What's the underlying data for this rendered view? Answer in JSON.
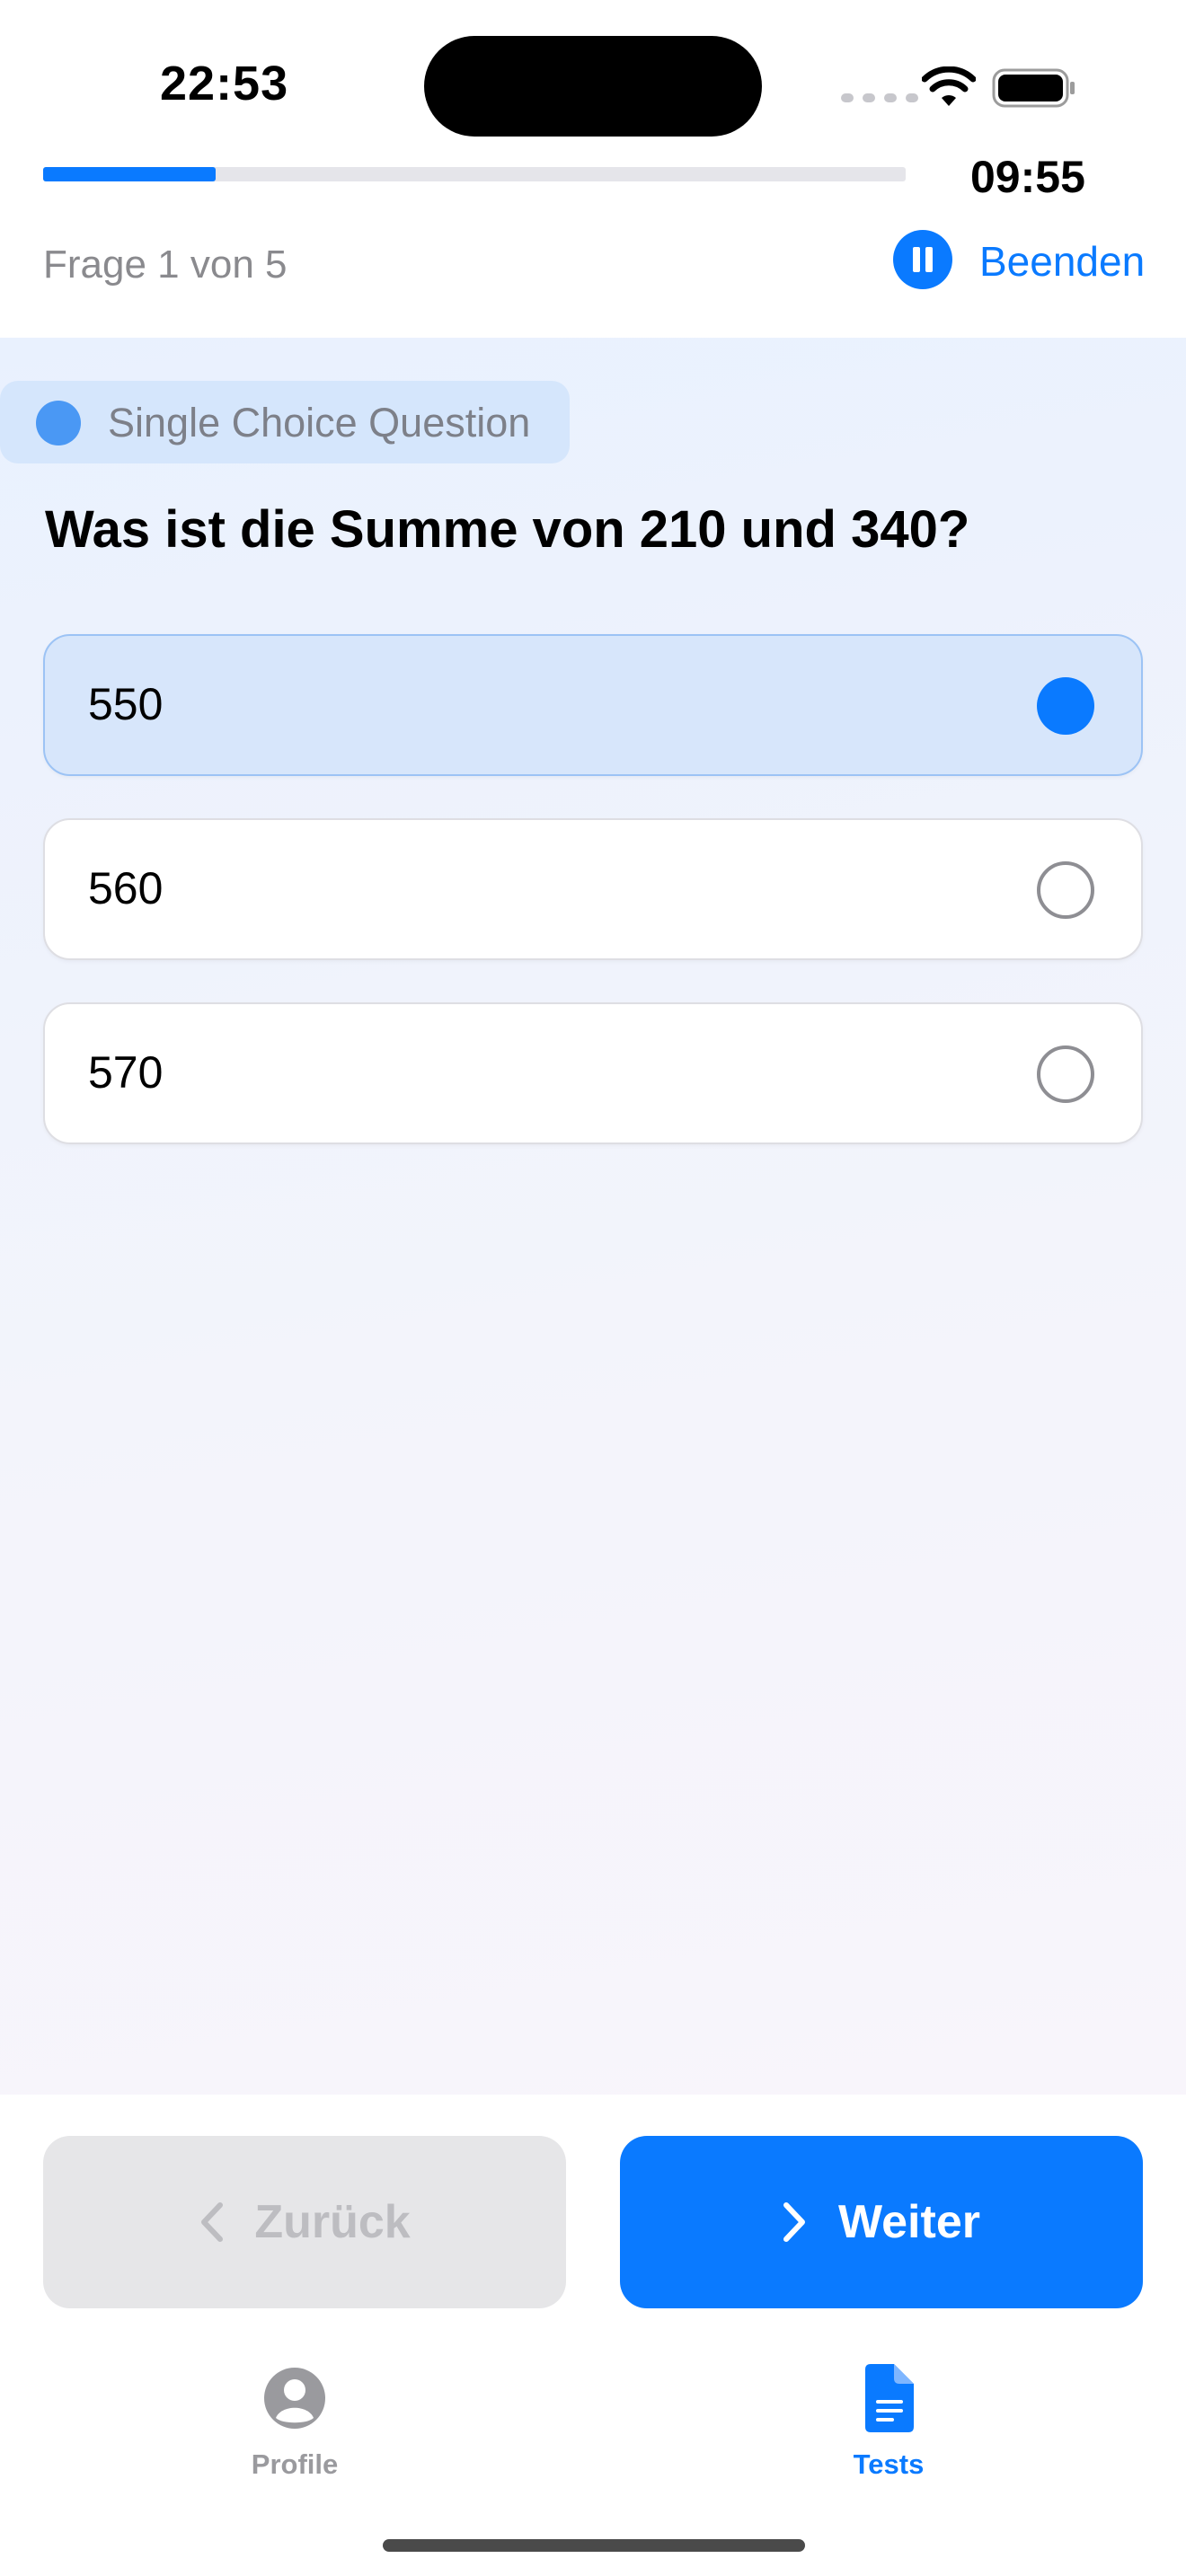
{
  "status_bar": {
    "time": "22:53",
    "icons": [
      "signal-dots-icon",
      "wifi-icon",
      "battery-icon"
    ]
  },
  "quiz_header": {
    "progress_fraction": 0.2,
    "timer": "09:55",
    "question_count": "Frage 1 von 5",
    "pause_icon": "pause-icon",
    "end_label": "Beenden"
  },
  "question": {
    "type_label": "Single Choice Question",
    "text": "Was ist die Summe von 210 und 340?",
    "options": [
      {
        "label": "550",
        "selected": true
      },
      {
        "label": "560",
        "selected": false
      },
      {
        "label": "570",
        "selected": false
      }
    ]
  },
  "navigation": {
    "back_label": "Zurück",
    "back_icon": "chevron-left-icon",
    "back_enabled": false,
    "next_label": "Weiter",
    "next_icon": "chevron-right-icon"
  },
  "tab_bar": {
    "items": [
      {
        "label": "Profile",
        "icon": "person-circle-icon",
        "active": false
      },
      {
        "label": "Tests",
        "icon": "document-icon",
        "active": true
      }
    ]
  },
  "colors": {
    "accent": "#0a7aff",
    "selected_option_bg": "#d7e6fb",
    "disabled_button_bg": "#e6e6e8"
  }
}
